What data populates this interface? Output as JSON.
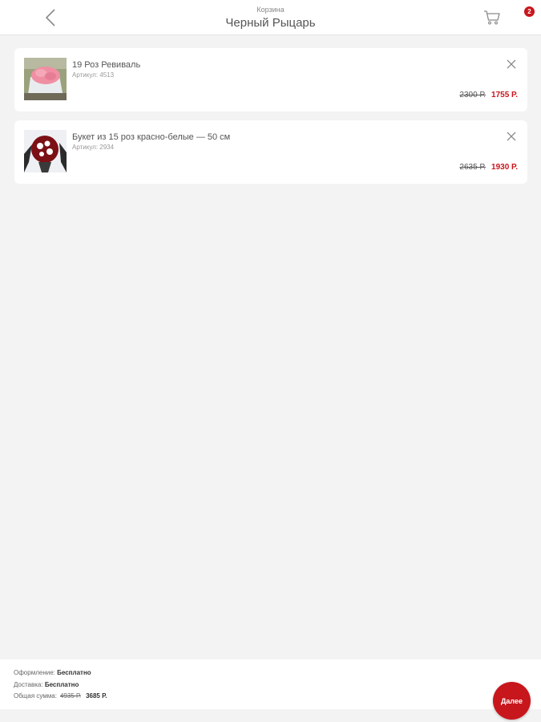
{
  "header": {
    "subtitle": "Корзина",
    "title": "Черный Рыцарь",
    "cart_count": "2"
  },
  "items": [
    {
      "name": "19 Роз Ревиваль",
      "sku": "Артикул: 4513",
      "old_price": "2300 Р.",
      "price": "1755 Р."
    },
    {
      "name": "Букет из 15 роз красно-белые — 50 см",
      "sku": "Артикул: 2934",
      "old_price": "2635 Р.",
      "price": "1930 Р."
    }
  ],
  "summary": {
    "checkout_label": "Оформление:",
    "checkout_value": "Бесплатно",
    "delivery_label": "Доставка:",
    "delivery_value": "Бесплатно",
    "total_label": "Общая сумма:",
    "total_old": "4935 Р.",
    "total_value": "3685 Р."
  },
  "next_button": "Далее",
  "colors": {
    "accent": "#c8161d",
    "background": "#f3f3f3",
    "card": "#ffffff"
  },
  "icons": {
    "back": "chevron-left-icon",
    "cart": "cart-icon",
    "remove": "close-icon"
  }
}
